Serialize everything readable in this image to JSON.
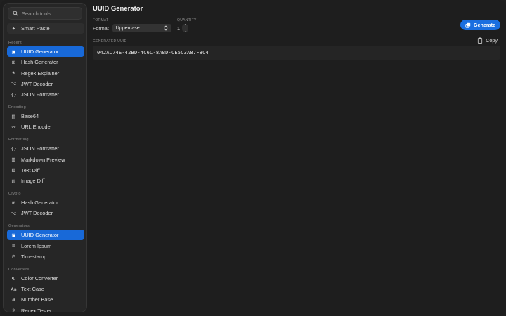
{
  "search": {
    "placeholder": "Search tools"
  },
  "sidebar": {
    "top_item": {
      "label": "Smart Paste",
      "icon": "sparkle-icon"
    },
    "sections": [
      {
        "title": "Recent",
        "items": [
          {
            "label": "UUID Generator",
            "icon": "uuid-icon",
            "active": true
          },
          {
            "label": "Hash Generator",
            "icon": "hash-icon"
          },
          {
            "label": "Regex Explainer",
            "icon": "regex-icon"
          },
          {
            "label": "JWT Decoder",
            "icon": "key-icon"
          },
          {
            "label": "JSON Formatter",
            "icon": "braces-icon"
          }
        ]
      },
      {
        "title": "Encoding",
        "items": [
          {
            "label": "Base64",
            "icon": "base64-icon"
          },
          {
            "label": "URL Encode",
            "icon": "link-icon"
          }
        ]
      },
      {
        "title": "Formatting",
        "items": [
          {
            "label": "JSON Formatter",
            "icon": "braces-icon"
          },
          {
            "label": "Markdown Preview",
            "icon": "markdown-icon"
          },
          {
            "label": "Text Diff",
            "icon": "diff-icon"
          },
          {
            "label": "Image Diff",
            "icon": "image-icon"
          }
        ]
      },
      {
        "title": "Crypto",
        "items": [
          {
            "label": "Hash Generator",
            "icon": "hash-icon"
          },
          {
            "label": "JWT Decoder",
            "icon": "key-icon"
          }
        ]
      },
      {
        "title": "Generators",
        "items": [
          {
            "label": "UUID Generator",
            "icon": "uuid-icon",
            "active": true
          },
          {
            "label": "Lorem Ipsum",
            "icon": "list-icon"
          },
          {
            "label": "Timestamp",
            "icon": "clock-icon"
          }
        ]
      },
      {
        "title": "Converters",
        "items": [
          {
            "label": "Color Converter",
            "icon": "palette-icon"
          },
          {
            "label": "Text Case",
            "icon": "text-case-icon"
          },
          {
            "label": "Number Base",
            "icon": "number-icon"
          },
          {
            "label": "Regex Tester",
            "icon": "regex-icon"
          }
        ]
      }
    ]
  },
  "main": {
    "title": "UUID Generator",
    "format_section_label": "FORMAT",
    "format_label": "Format",
    "format_value": "Uppercase",
    "quantity_label": "QUANTITY",
    "quantity_value": "1",
    "generate_label": "Generate",
    "output_label": "GENERATED UUID",
    "copy_label": "Copy",
    "uuid": "042AC74E-42BD-4C6C-8ABD-CE5C3A87F8C4"
  },
  "colors": {
    "accent": "#1a6ee0",
    "sidebar_bg": "#262626",
    "window_bg": "#1e1e1e"
  }
}
